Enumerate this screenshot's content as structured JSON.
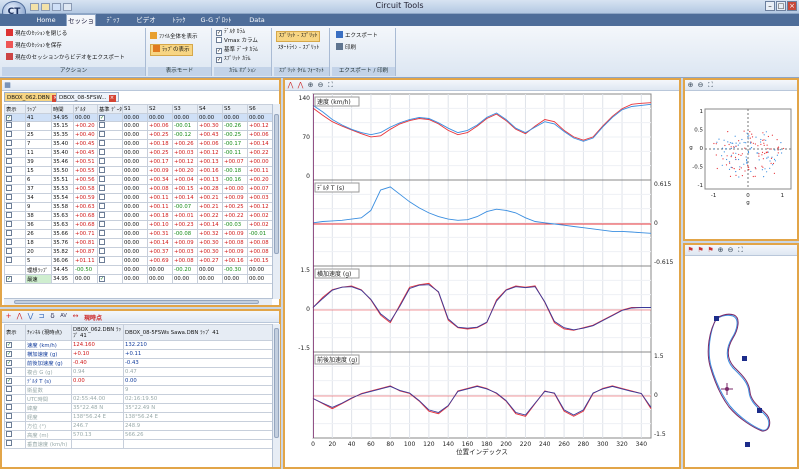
{
  "app": {
    "title": "Circuit Tools",
    "logo": "CT"
  },
  "tabs": [
    "Home",
    "セッション",
    "ﾃﾞｯﾌ",
    "ビデオ",
    "ﾄﾗｯｸ",
    "G-G ﾌﾟﾛｯﾄ",
    "Data"
  ],
  "ribbon": {
    "actions": {
      "label": "アクション",
      "items": [
        "現在のｾｯｼｮﾝを閉じる",
        "現在のｾｯｼｮﾝを保存",
        "現在のセッションからビデオをエクスポート"
      ]
    },
    "display": {
      "label": "表示モード",
      "items": [
        "ﾌｧｲﾙ全体を表示",
        "ﾗｯﾌﾟの表示"
      ]
    },
    "columns": {
      "label": "ｶﾗﾑ ｵﾌﾟｼｮﾝ",
      "items": [
        "ﾃﾞﾙﾀ ｶﾗﾑ",
        "Vmax カラム",
        "基準 ﾃﾞｰﾀ ｶﾗﾑ",
        "ｽﾌﾟﾘｯﾄ ｶﾗﾑ"
      ]
    },
    "split": {
      "label": "ｽﾌﾟﾘｯﾄ ﾀｲﾑ ﾌｫｰﾏｯﾄ",
      "items": [
        "ｽﾌﾟﾘｯﾄ - ｽﾌﾟﾘｯﾄ",
        "ｽﾀｰﾄﾗｲﾝ - ｽﾌﾟﾘｯﾄ"
      ]
    },
    "export": {
      "label": "エクスポート / 印刷",
      "items": [
        "エクスポート",
        "印刷"
      ]
    }
  },
  "files": [
    "DBOX_062.DBN",
    "DBOX_08-5FSW..."
  ],
  "laps": {
    "headers": [
      "表示",
      "ﾗｯﾌﾟ",
      "時間",
      "ﾃﾞﾙﾀ",
      "基準 ﾃﾞｰﾀ",
      "S1",
      "S2",
      "S3",
      "S4",
      "S5",
      "S6"
    ],
    "rows": [
      {
        "show": true,
        "lap": "41",
        "time": "34.95",
        "delta": "00.00",
        "ref": true,
        "s": [
          "00.00",
          "00.00",
          "00.00",
          "00.00",
          "00.00",
          "00.00"
        ],
        "sel": true
      },
      {
        "show": false,
        "lap": "8",
        "time": "35.15",
        "delta": "+00.20",
        "ref": false,
        "s": [
          "00.00",
          "+00.06",
          "-00.01",
          "+00.30",
          "-00.26",
          "+00.12"
        ]
      },
      {
        "show": false,
        "lap": "25",
        "time": "35.35",
        "delta": "+00.40",
        "ref": false,
        "s": [
          "00.00",
          "+00.25",
          "-00.12",
          "+00.43",
          "-00.25",
          "+00.06"
        ]
      },
      {
        "show": false,
        "lap": "7",
        "time": "35.40",
        "delta": "+00.45",
        "ref": false,
        "s": [
          "00.00",
          "+00.18",
          "+00.26",
          "+00.06",
          "-00.17",
          "+00.14"
        ]
      },
      {
        "show": false,
        "lap": "11",
        "time": "35.40",
        "delta": "+00.45",
        "ref": false,
        "s": [
          "00.00",
          "+00.25",
          "+00.03",
          "+00.12",
          "-00.11",
          "+00.22"
        ]
      },
      {
        "show": false,
        "lap": "39",
        "time": "35.46",
        "delta": "+00.51",
        "ref": false,
        "s": [
          "00.00",
          "+00.17",
          "+00.12",
          "+00.13",
          "+00.07",
          "+00.00"
        ]
      },
      {
        "show": false,
        "lap": "15",
        "time": "35.50",
        "delta": "+00.55",
        "ref": false,
        "s": [
          "00.00",
          "+00.09",
          "+00.20",
          "+00.16",
          "-00.18",
          "+00.11"
        ]
      },
      {
        "show": false,
        "lap": "6",
        "time": "35.51",
        "delta": "+00.56",
        "ref": false,
        "s": [
          "00.00",
          "+00.34",
          "+00.04",
          "+00.13",
          "-00.16",
          "+00.20"
        ]
      },
      {
        "show": false,
        "lap": "37",
        "time": "35.53",
        "delta": "+00.58",
        "ref": false,
        "s": [
          "00.00",
          "+00.08",
          "+00.15",
          "+00.28",
          "+00.00",
          "+00.07"
        ]
      },
      {
        "show": false,
        "lap": "34",
        "time": "35.54",
        "delta": "+00.59",
        "ref": false,
        "s": [
          "00.00",
          "+00.11",
          "+00.14",
          "+00.21",
          "+00.09",
          "+00.03"
        ]
      },
      {
        "show": false,
        "lap": "9",
        "time": "35.58",
        "delta": "+00.63",
        "ref": false,
        "s": [
          "00.00",
          "+00.11",
          "-00.07",
          "+00.21",
          "+00.25",
          "+00.12"
        ]
      },
      {
        "show": false,
        "lap": "38",
        "time": "35.63",
        "delta": "+00.68",
        "ref": false,
        "s": [
          "00.00",
          "+00.18",
          "+00.01",
          "+00.22",
          "+00.22",
          "+00.02"
        ]
      },
      {
        "show": false,
        "lap": "36",
        "time": "35.63",
        "delta": "+00.68",
        "ref": false,
        "s": [
          "00.00",
          "+00.10",
          "+00.23",
          "+00.14",
          "-00.03",
          "+00.02"
        ]
      },
      {
        "show": false,
        "lap": "26",
        "time": "35.66",
        "delta": "+00.71",
        "ref": false,
        "s": [
          "00.00",
          "+00.31",
          "-00.08",
          "+00.32",
          "+00.09",
          "-00.01"
        ]
      },
      {
        "show": false,
        "lap": "18",
        "time": "35.76",
        "delta": "+00.81",
        "ref": false,
        "s": [
          "00.00",
          "+00.14",
          "+00.09",
          "+00.30",
          "+00.08",
          "+00.08"
        ]
      },
      {
        "show": false,
        "lap": "20",
        "time": "35.82",
        "delta": "+00.87",
        "ref": false,
        "s": [
          "00.00",
          "+00.37",
          "+00.03",
          "+00.30",
          "+00.09",
          "+00.08"
        ]
      },
      {
        "show": false,
        "lap": "5",
        "time": "36.06",
        "delta": "+01.11",
        "ref": false,
        "s": [
          "00.00",
          "+00.69",
          "+00.08",
          "+00.27",
          "+00.16",
          "+00.15"
        ]
      }
    ],
    "summary": [
      {
        "label": "理想ﾗｯﾌﾟ",
        "time": "34.45",
        "delta": "-00.50",
        "s": [
          "00.00",
          "00.00",
          "-00.20",
          "00.00",
          "-00.30",
          "00.00"
        ]
      },
      {
        "label": "最速",
        "time": "34.95",
        "delta": "00.00",
        "s": [
          "00.00",
          "00.00",
          "00.00",
          "00.00",
          "00.00",
          "00.00"
        ]
      }
    ]
  },
  "channels": {
    "toolbar_label": "現時点",
    "headers": [
      "表示",
      "ﾁｬﾝﾈﾙ (現時点)",
      "DBOX_062.DBN ﾗｯﾌﾟ 41",
      "DBOX_08-5FSWs Sawa.DBN ﾗｯﾌﾟ 41"
    ],
    "rows": [
      {
        "show": true,
        "name": "速度 (km/h)",
        "a": "124.160",
        "b": "132.210",
        "active": true
      },
      {
        "show": true,
        "name": "横加速度 (g)",
        "a": "+0.10",
        "b": "+0.11",
        "active": true
      },
      {
        "show": true,
        "name": "前後加速度 (g)",
        "a": "-0.40",
        "b": "-0.43",
        "active": true
      },
      {
        "show": false,
        "name": "複合 G (g)",
        "a": "0.94",
        "b": "0.47",
        "active": false
      },
      {
        "show": true,
        "name": "ﾃﾞﾙﾀ T (s)",
        "a": "0.00",
        "b": "0.00",
        "active": true
      },
      {
        "show": false,
        "name": "衛星数",
        "a": "",
        "b": "9",
        "active": false
      },
      {
        "show": false,
        "name": "UTC時間",
        "a": "02:55:44.00",
        "b": "02:16:19.50",
        "active": false
      },
      {
        "show": false,
        "name": "緯度",
        "a": "35°22.48 N",
        "b": "35°22.49 N",
        "active": false
      },
      {
        "show": false,
        "name": "経度",
        "a": "138°56.24 E",
        "b": "138°56.24 E",
        "active": false
      },
      {
        "show": false,
        "name": "方位 (°)",
        "a": "246.7",
        "b": "248.9",
        "active": false
      },
      {
        "show": false,
        "name": "高度 (m)",
        "a": "570.13",
        "b": "566.26",
        "active": false
      },
      {
        "show": false,
        "name": "垂直速度 (km/h)",
        "a": "",
        "b": "",
        "active": false
      }
    ]
  },
  "chart_data": [
    {
      "type": "line",
      "title": "",
      "ylabel": "速度 (km/h)",
      "xlabel": "位置インデックス",
      "ylim": [
        0,
        140
      ],
      "left_ticks": [
        "140",
        "70",
        "0"
      ],
      "x": [
        0,
        10,
        20,
        30,
        40,
        50,
        60,
        70,
        80,
        90,
        100,
        110,
        120,
        130,
        140,
        150,
        160,
        170,
        180,
        190,
        200,
        210,
        220,
        230,
        240,
        250,
        260,
        270,
        280,
        290,
        300,
        310,
        320,
        330,
        340,
        350
      ],
      "series": [
        {
          "color": "#e8343a",
          "values": [
            125,
            112,
            100,
            92,
            85,
            78,
            72,
            74,
            86,
            96,
            102,
            106,
            104,
            96,
            84,
            76,
            80,
            92,
            106,
            114,
            102,
            86,
            78,
            92,
            104,
            100,
            84,
            72,
            66,
            72,
            92,
            110,
            124,
            132,
            134,
            135
          ]
        },
        {
          "color": "#3a8ee0",
          "values": [
            130,
            118,
            104,
            94,
            86,
            80,
            76,
            80,
            90,
            98,
            104,
            108,
            106,
            98,
            88,
            80,
            84,
            94,
            108,
            116,
            104,
            88,
            80,
            90,
            100,
            96,
            82,
            70,
            64,
            70,
            90,
            108,
            122,
            128,
            130,
            132
          ]
        }
      ]
    },
    {
      "type": "line",
      "ylabel": "ﾃﾞﾙﾀ T (s)",
      "right_ticks": [
        "0.615",
        "0",
        "-0.615"
      ],
      "ylim": [
        -0.615,
        0.615
      ],
      "x": [
        0,
        10,
        20,
        30,
        40,
        50,
        60,
        70,
        80,
        90,
        100,
        110,
        120,
        130,
        140,
        150,
        160,
        170,
        180,
        190,
        200,
        210,
        220,
        230,
        240,
        250,
        260,
        270,
        280,
        290,
        300,
        310,
        320,
        330,
        340,
        350
      ],
      "series": [
        {
          "color": "#e8343a",
          "values": [
            0,
            0,
            0,
            0,
            0,
            0,
            0,
            0,
            0,
            0,
            0,
            0,
            0,
            0,
            0,
            0,
            0,
            0,
            0,
            0,
            0,
            0,
            0,
            0,
            0,
            0,
            0,
            0,
            0,
            0,
            0,
            0,
            0,
            0,
            0,
            0
          ]
        },
        {
          "color": "#3a8ee0",
          "values": [
            0.02,
            0.04,
            0.05,
            0.06,
            0.08,
            0.1,
            0.22,
            0.55,
            0.6,
            0.48,
            0.36,
            0.26,
            0.18,
            0.12,
            0.08,
            0.06,
            0.07,
            0.12,
            0.2,
            0.24,
            0.22,
            0.18,
            0.1,
            0.04,
            0.02,
            0.0,
            -0.02,
            -0.04,
            -0.06,
            -0.08,
            -0.1,
            -0.12,
            -0.12,
            -0.13,
            -0.14,
            -0.15
          ]
        }
      ]
    },
    {
      "type": "line",
      "ylabel": "横加速度 (g)",
      "left_ticks": [
        "1.5",
        "0",
        "-1.5"
      ],
      "ylim": [
        -1.5,
        1.5
      ],
      "x": [
        0,
        10,
        20,
        30,
        40,
        50,
        60,
        70,
        80,
        90,
        100,
        110,
        120,
        130,
        140,
        150,
        160,
        170,
        180,
        190,
        200,
        210,
        220,
        230,
        240,
        250,
        260,
        270,
        280,
        290,
        300,
        310,
        320,
        330,
        340,
        350
      ],
      "series": [
        {
          "color": "#e8343a",
          "values": [
            0.1,
            0.5,
            0.8,
            0.9,
            0.95,
            0.8,
            0.4,
            -0.2,
            -0.5,
            0.2,
            0.9,
            1.0,
            1.05,
            0.7,
            -0.4,
            -0.7,
            -0.75,
            -0.7,
            -0.5,
            0.4,
            0.8,
            0.95,
            0.9,
            0.95,
            0.3,
            -0.5,
            -0.75,
            -0.8,
            -0.7,
            -0.6,
            -0.4,
            -0.2,
            0,
            0.1,
            0.1,
            0.1
          ]
        },
        {
          "color": "#3a3a9a",
          "values": [
            0.1,
            0.45,
            0.78,
            0.9,
            0.92,
            0.78,
            0.42,
            -0.15,
            -0.45,
            0.15,
            0.85,
            0.98,
            1.0,
            0.72,
            -0.35,
            -0.68,
            -0.72,
            -0.68,
            -0.48,
            0.35,
            0.78,
            0.92,
            0.88,
            0.92,
            0.32,
            -0.45,
            -0.7,
            -0.78,
            -0.72,
            -0.62,
            -0.42,
            -0.22,
            -0.02,
            0.08,
            0.1,
            0.1
          ]
        }
      ]
    },
    {
      "type": "line",
      "ylabel": "前後加速度 (g)",
      "right_ticks": [
        "1.5",
        "0",
        "-1.5"
      ],
      "ylim": [
        -1.5,
        1.5
      ],
      "x": [
        0,
        10,
        20,
        30,
        40,
        50,
        60,
        70,
        80,
        90,
        100,
        110,
        120,
        130,
        140,
        150,
        160,
        170,
        180,
        190,
        200,
        210,
        220,
        230,
        240,
        250,
        260,
        270,
        280,
        290,
        300,
        310,
        320,
        330,
        340,
        350
      ],
      "series": [
        {
          "color": "#e8343a",
          "values": [
            -0.1,
            -0.3,
            -0.5,
            -0.3,
            -0.1,
            0.1,
            0.2,
            0.3,
            0.4,
            0.2,
            0.1,
            -0.2,
            -0.6,
            -0.7,
            -0.4,
            0.2,
            0.3,
            0.4,
            0.3,
            0.1,
            -0.2,
            -0.7,
            -0.8,
            -0.3,
            0.2,
            0.1,
            -0.6,
            -0.8,
            -0.6,
            0.1,
            0.3,
            0.4,
            0.3,
            0.2,
            0.1,
            -0.5
          ]
        },
        {
          "color": "#3a3a9a",
          "values": [
            -0.1,
            -0.28,
            -0.45,
            -0.28,
            -0.08,
            0.08,
            0.18,
            0.28,
            0.38,
            0.22,
            0.12,
            -0.18,
            -0.55,
            -0.65,
            -0.38,
            0.18,
            0.28,
            0.38,
            0.28,
            0.12,
            -0.18,
            -0.65,
            -0.75,
            -0.28,
            0.18,
            0.12,
            -0.55,
            -0.75,
            -0.55,
            0.12,
            0.28,
            0.38,
            0.28,
            0.18,
            0.1,
            -0.45
          ]
        }
      ]
    }
  ],
  "x_axis": {
    "label": "位置インデックス",
    "ticks": [
      "0",
      "20",
      "40",
      "60",
      "80",
      "100",
      "120",
      "140",
      "160",
      "180",
      "200",
      "220",
      "240",
      "260",
      "280",
      "300",
      "320",
      "340"
    ]
  },
  "gg": {
    "ylabel": "g",
    "xlabel": "g",
    "xticks": [
      "-1",
      "0",
      "1"
    ],
    "yticks": [
      "1",
      "0.5",
      "0",
      "-0.5",
      "-1"
    ]
  },
  "colors": {
    "red": "#e8343a",
    "blue": "#3a8ee0",
    "accent": "#e2a548"
  }
}
